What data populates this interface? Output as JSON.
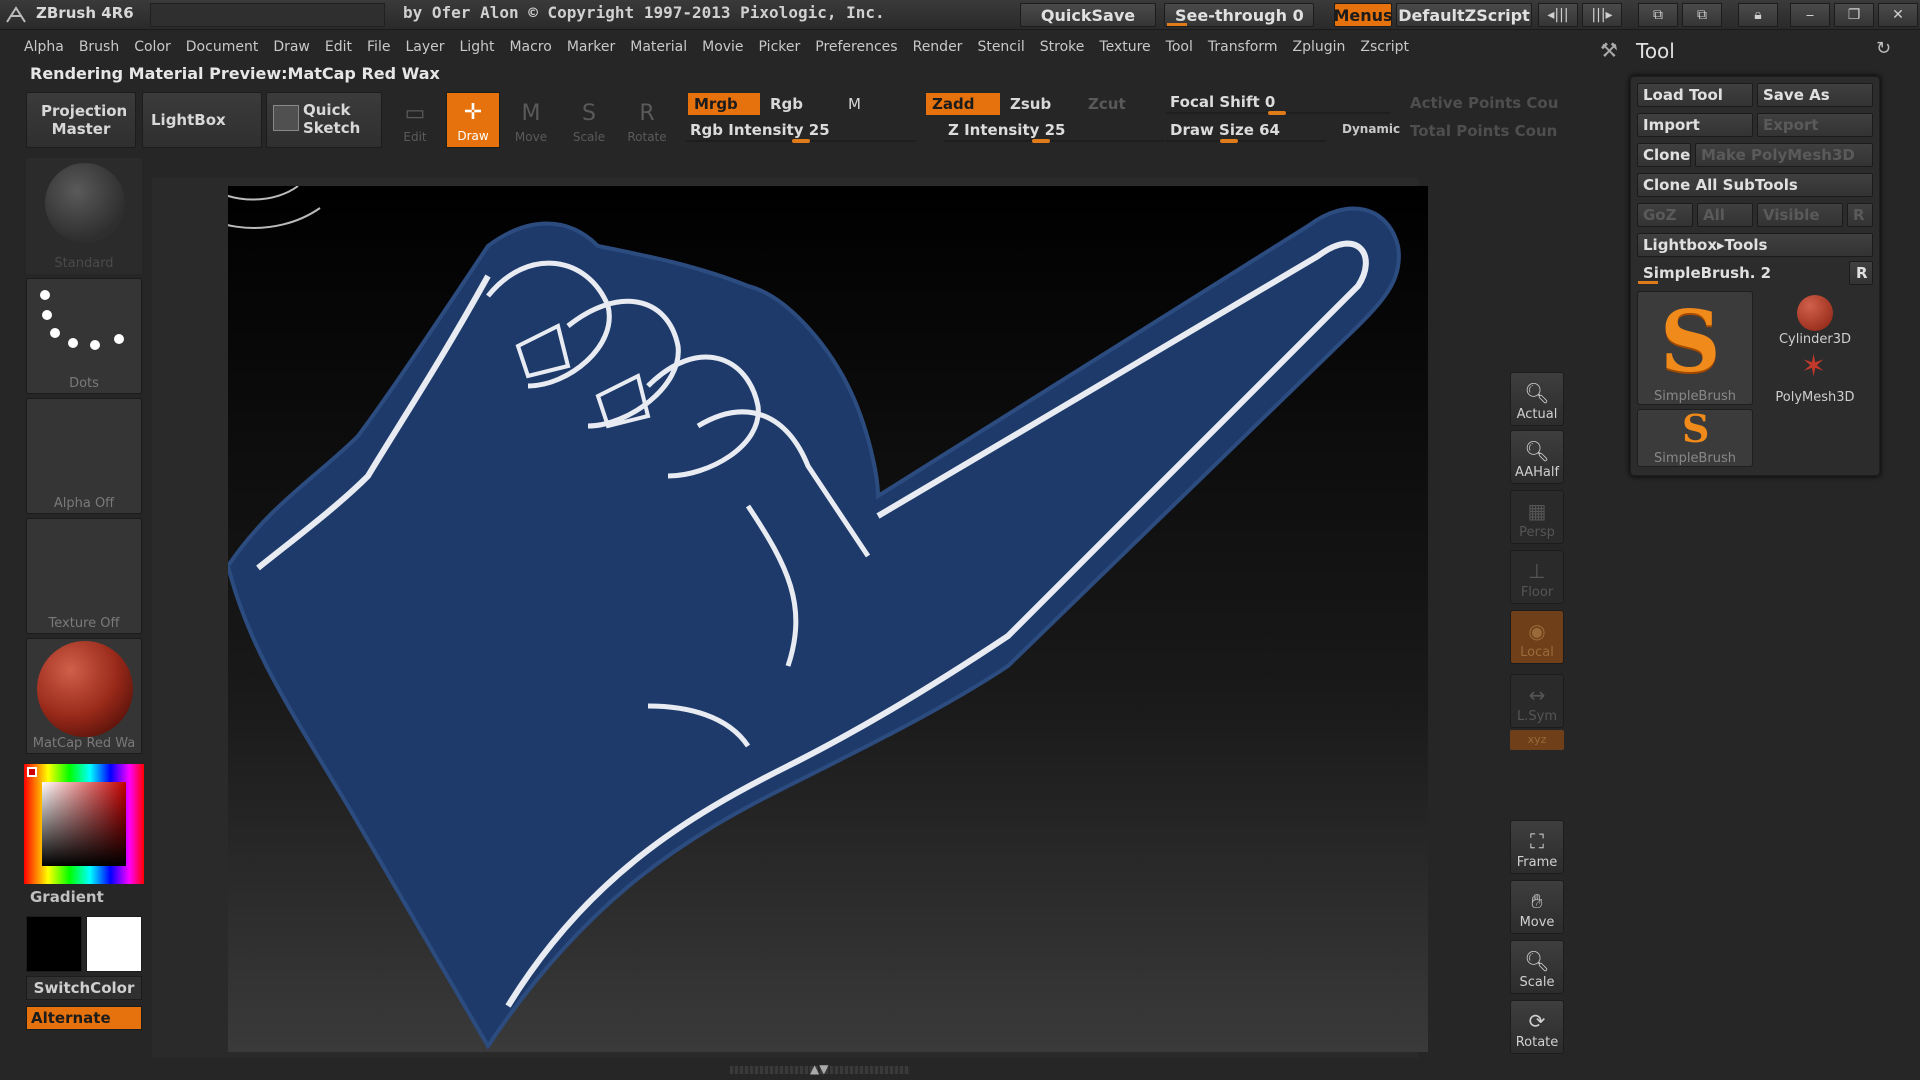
{
  "titlebar": {
    "app_title": "ZBrush 4R6",
    "copyright": "by Ofer Alon © Copyright 1997-2013 Pixologic, Inc.",
    "quicksave": "QuickSave",
    "see_through": "See-through  0",
    "menus": "Menus",
    "default_zscript": "DefaultZScript"
  },
  "menu": [
    "Alpha",
    "Brush",
    "Color",
    "Document",
    "Draw",
    "Edit",
    "File",
    "Layer",
    "Light",
    "Macro",
    "Marker",
    "Material",
    "Movie",
    "Picker",
    "Preferences",
    "Render",
    "Stencil",
    "Stroke",
    "Texture",
    "Tool",
    "Transform",
    "Zplugin",
    "Zscript"
  ],
  "status": "Rendering Material Preview:MatCap Red Wax",
  "shelf": {
    "projection_master": "Projection Master",
    "lightbox": "LightBox",
    "quick_sketch": "Quick Sketch",
    "modes": [
      {
        "label": "Edit",
        "glyph": "▭",
        "active": false
      },
      {
        "label": "Draw",
        "glyph": "✛",
        "active": true
      },
      {
        "label": "Move",
        "glyph": "M",
        "active": false
      },
      {
        "label": "Scale",
        "glyph": "S",
        "active": false
      },
      {
        "label": "Rotate",
        "glyph": "R",
        "active": false
      }
    ],
    "mrgb": "Mrgb",
    "rgb": "Rgb",
    "m": "M",
    "zadd": "Zadd",
    "zsub": "Zsub",
    "zcut": "Zcut",
    "rgb_intensity": "Rgb Intensity 25",
    "z_intensity": "Z Intensity 25",
    "focal_shift": "Focal Shift 0",
    "draw_size": "Draw Size 64",
    "dynamic": "Dynamic",
    "active_points": "Active Points Cou",
    "total_points": "Total Points Coun"
  },
  "left_tray": {
    "brush": "Standard",
    "stroke": "Dots",
    "alpha": "Alpha Off",
    "texture": "Texture Off",
    "material": "MatCap Red Wa",
    "gradient": "Gradient",
    "switch_color": "SwitchColor",
    "alternate": "Alternate"
  },
  "right_shelf": {
    "actual": "Actual",
    "aahalf": "AAHalf",
    "persp": "Persp",
    "floor": "Floor",
    "local": "Local",
    "lsym": "L.Sym",
    "frame": "Frame",
    "move": "Move",
    "scale": "Scale",
    "rotate": "Rotate"
  },
  "tool_palette": {
    "title": "Tool",
    "load_tool": "Load Tool",
    "save_as": "Save As",
    "import": "Import",
    "export": "Export",
    "clone": "Clone",
    "make_polymesh": "Make PolyMesh3D",
    "clone_all": "Clone All SubTools",
    "goz": "GoZ",
    "all": "All",
    "visible": "Visible",
    "r": "R",
    "lightbox_tools": "Lightbox▸Tools",
    "current_tool": "SimpleBrush. 2",
    "tools": [
      "SimpleBrush",
      "Cylinder3D",
      "PolyMesh3D",
      "SimpleBrush"
    ]
  },
  "colors": {
    "accent": "#e5720c",
    "hand_blue": "#1e3a6e",
    "outline": "#e8ecf2"
  }
}
